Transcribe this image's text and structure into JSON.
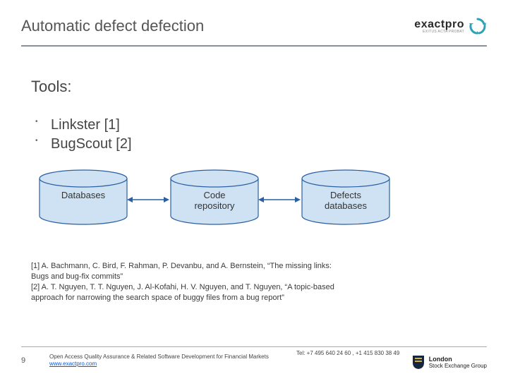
{
  "title": "Automatic defect defection",
  "brand": {
    "name": "exactpro",
    "tagline": "EXITUS ACTA PROBAT"
  },
  "tools_heading": "Tools:",
  "bullets": [
    "Linkster [1]",
    "BugScout [2]"
  ],
  "diagram": {
    "nodes": {
      "db": "Databases",
      "code_l1": "Code",
      "code_l2": "repository",
      "def_l1": "Defects",
      "def_l2": "databases"
    }
  },
  "refs": {
    "r1": "[1] A. Bachmann, C. Bird, F. Rahman, P. Devanbu, and A. Bernstein, “The missing links: Bugs and bug-fix commits”",
    "r2": "[2] A. T. Nguyen, T. T. Nguyen, J. Al-Kofahi, H. V. Nguyen, and T. Nguyen, “A topic-based approach for narrowing the search space of buggy files from a bug report”"
  },
  "footer": {
    "page": "9",
    "line1": "Open Access Quality Assurance & Related Software Development for Financial Markets",
    "link": "www.exactpro.com",
    "tel": "Tel: +7 495 640 24 60 ,   +1 415 830 38 49",
    "lse_top": "London",
    "lse_bottom": "Stock Exchange Group"
  }
}
